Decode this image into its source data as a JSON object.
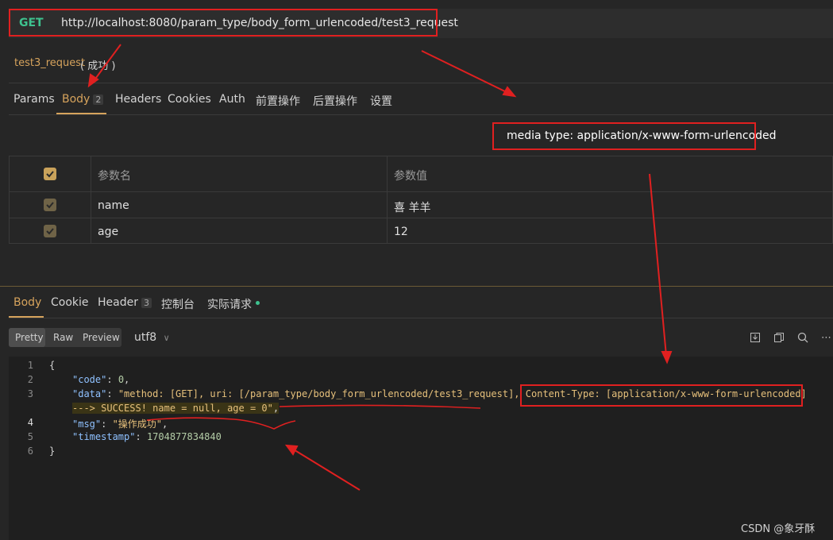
{
  "request": {
    "method": "GET",
    "url": "http://localhost:8080/param_type/body_form_urlencoded/test3_request",
    "name": "test3_request",
    "status": "( 成功 )"
  },
  "request_tabs": [
    {
      "label": "Params"
    },
    {
      "label": "Body",
      "badge": "2"
    },
    {
      "label": "Headers"
    },
    {
      "label": "Cookies"
    },
    {
      "label": "Auth"
    },
    {
      "label": "前置操作"
    },
    {
      "label": "后置操作"
    },
    {
      "label": "设置"
    }
  ],
  "media_type": "media type: application/x-www-form-urlencoded",
  "params_table": {
    "headers": [
      "参数名",
      "参数值"
    ],
    "rows": [
      {
        "name": "name",
        "value": "喜 羊羊"
      },
      {
        "name": "age",
        "value": "12"
      }
    ]
  },
  "response_tabs": [
    {
      "label": "Body"
    },
    {
      "label": "Cookie"
    },
    {
      "label": "Header",
      "badge": "3"
    },
    {
      "label": "控制台"
    },
    {
      "label": "实际请求"
    }
  ],
  "format_buttons": [
    "Pretty",
    "Raw",
    "Preview"
  ],
  "encoding": "utf8",
  "code_lines": {
    "n1": "1",
    "n2": "2",
    "n3": "3",
    "n4": "4",
    "n5": "5",
    "n6": "6",
    "l1_open": "{",
    "l2_key": "\"code\"",
    "l2_val": "0",
    "l3_key": "\"data\"",
    "l3_val_a": "\"method: [GET], uri: [/param_type/body_form_urlencoded/test3_request], ",
    "l3_val_b": "Content-Type: [application/x-www-form-urlencoded]",
    "l3_cont": "---> SUCCESS! name = null, age = 0\"",
    "l4_key": "\"msg\"",
    "l4_val": "\"操作成功\"",
    "l5_key": "\"timestamp\"",
    "l5_val": "1704877834840",
    "l6_close": "}"
  },
  "watermark": "CSDN @象牙酥",
  "colors": {
    "accent": "#d6a35c",
    "method": "#3ec28f",
    "annotation": "#e02020"
  }
}
